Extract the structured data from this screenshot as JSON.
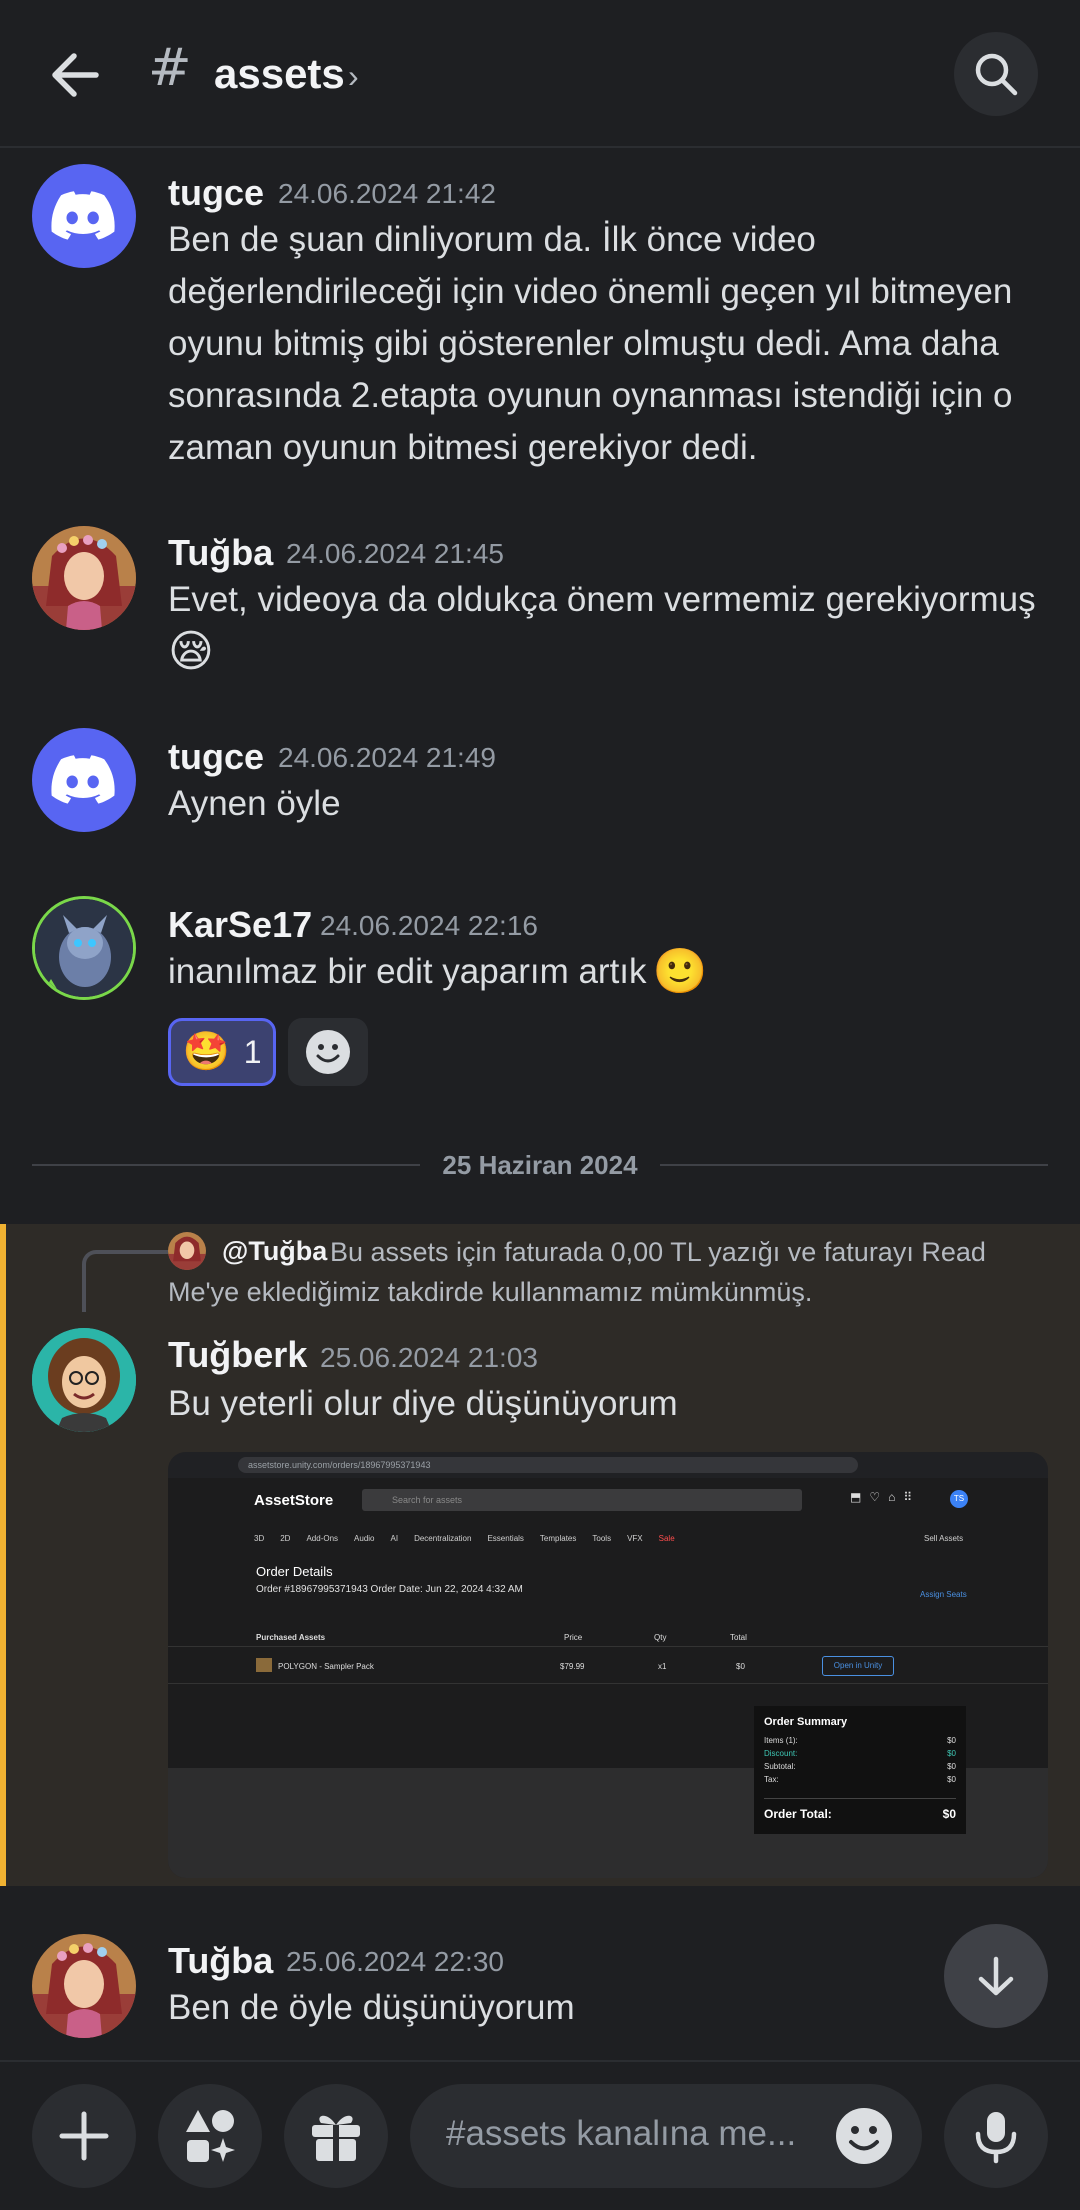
{
  "header": {
    "channel_prefix": "#",
    "channel_name": "assets",
    "chevron": "›"
  },
  "messages": [
    {
      "author": "tugce",
      "timestamp": "24.06.2024 21:42",
      "lines": [
        "Ben de şuan dinliyorum da. İlk önce video",
        "değerlendirileceği için video önemli geçen yıl bitmeyen",
        "oyunu bitmiş gibi gösterenler olmuştu dedi. Ama daha",
        "sonrasında 2.etapta oyunun oynanması istendiği için o",
        "zaman oyunun bitmesi gerekiyor dedi."
      ]
    },
    {
      "author": "Tuğba",
      "timestamp": "24.06.2024 21:45",
      "lines": [
        "Evet, videoya da oldukça önem vermemiz gerekiyormuş"
      ],
      "emoji": "😪"
    },
    {
      "author": "tugce",
      "timestamp": "24.06.2024 21:49",
      "lines": [
        "Aynen öyle"
      ]
    },
    {
      "author": "KarSe17",
      "timestamp": "24.06.2024 22:16",
      "text": "inanılmaz bir edit yaparım artık",
      "emoji": "🙂",
      "reaction": {
        "emoji": "🤩",
        "count": "1"
      }
    },
    {
      "author": "Tuğberk",
      "timestamp": "25.06.2024 21:03",
      "text": "Bu yeterli olur diye düşünüyorum",
      "reply": {
        "author": "@Tuğba",
        "text": "Bu assets için faturada 0,00 TL yazığı ve faturayı Read Me'ye eklediğimiz takdirde kullanmamız mümkünmüş."
      }
    },
    {
      "author": "Tuğba",
      "timestamp": "25.06.2024 22:30",
      "text": "Ben de öyle düşünüyorum"
    }
  ],
  "date_divider": "25 Haziran 2024",
  "attachment": {
    "url": "assetstore.unity.com/orders/18967995371943",
    "logo": "AssetStore",
    "search_placeholder": "Search for assets",
    "avatar_initials": "TS",
    "menu": [
      "3D",
      "2D",
      "Add-Ons",
      "Audio",
      "AI",
      "Decentralization",
      "Essentials",
      "Templates",
      "Tools",
      "VFX"
    ],
    "menu_sale": "Sale",
    "sell_assets": "Sell Assets",
    "order_details": "Order Details",
    "order_line": "Order #18967995371943     Order Date: Jun 22, 2024 4:32 AM",
    "assign_seats": "Assign Seats",
    "col_purchased": "Purchased Assets",
    "col_price": "Price",
    "col_qty": "Qty",
    "col_total": "Total",
    "item_name": "POLYGON - Sampler Pack",
    "item_price": "$79.99",
    "item_qty": "x1",
    "item_total": "$0",
    "open_in_unity": "Open in Unity",
    "summary_title": "Order Summary",
    "summary": [
      {
        "label": "Items (1):",
        "value": "$0"
      },
      {
        "label": "Discount:",
        "value": "$0"
      },
      {
        "label": "Subtotal:",
        "value": "$0"
      },
      {
        "label": "Tax:",
        "value": "$0"
      }
    ],
    "order_total_label": "Order Total:",
    "order_total_value": "$0"
  },
  "composer": {
    "placeholder": "#assets kanalına me..."
  },
  "colors": {
    "background": "#1e1f22",
    "blurple": "#5865f2",
    "highlight_bar": "#f0b232",
    "highlight_bg": "#2e2b27"
  },
  "icons": [
    "arrow-left-icon",
    "search-icon",
    "discord-logo-icon",
    "add-emoji-icon",
    "arrow-down-icon",
    "plus-icon",
    "apps-icon",
    "gift-icon",
    "emoji-icon",
    "microphone-icon"
  ]
}
